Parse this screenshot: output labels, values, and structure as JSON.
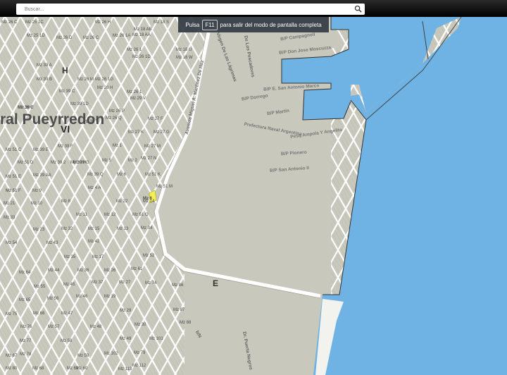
{
  "search": {
    "placeholder": "Buscar..."
  },
  "fullscreen": {
    "before": "Pulsa",
    "key": "F11",
    "after": "para salir del modo de pantalla completa"
  },
  "colors": {
    "sea": "#6fb2e4",
    "land": "#c8c8bc",
    "block": "#c2c4b8",
    "street": "#ffffff",
    "highlight": "#f5ef55"
  },
  "map": {
    "district_name": "ral Pueyrredon",
    "district_roman": "VI",
    "letter_h": "H",
    "letter_e": "E",
    "avenue": "Avenida Miguel A. Martinez De Hoz",
    "streets": [
      "Virgen De Las Lágrimas",
      "De Los Pescadores",
      "Pesq Ampola Y Angelito",
      "Prefectura Naval Argentina",
      "Dr. Puerta Negros",
      "b/N"
    ],
    "port_labels": [
      "B/P Campagnoli",
      "B/P Don Jose Moscuzza",
      "B/P E. San Antonio Marco",
      "B/P Dorrego",
      "B/P Martin",
      "B/P Pionero",
      "B/P San Antonio II"
    ],
    "blocks": [
      "Mz 26 C",
      "Mz 25 1C",
      "Mz 26 H",
      "Mz 18 AB",
      "Mz 18 S",
      "Mz 25 1D",
      "Mz 26 D",
      "Mz 26 C",
      "Mz 26 1A",
      "Mz 18 AA",
      "Mz 26 1",
      "Mz 26 1D",
      "Mz 18 U",
      "Mz 39 A",
      "Mz 39 B",
      "Mz 26 1G",
      "Mz 18 W",
      "Mz 39 C",
      "Mz 26 M",
      "Mz 26 H",
      "Mz 26 1",
      "Mz 29 V",
      "Mz 39 F",
      "Mz 26 P",
      "Mz 26 Q",
      "Mz 27 K",
      "Mz 27 G",
      "Mz 27 F",
      "Mz 39 C",
      "Mz 39 1D",
      "Mz 39 T",
      "Mz 1",
      "Mz 27 M",
      "Mz 51 C",
      "Mz 39 E",
      "Mz 39 F",
      "Mz 39 G",
      "Mz 51 D",
      "Mz 39 2",
      "Mz 39 H",
      "Mz 39 Q",
      "Mz 2",
      "Mz 27 N",
      "Mz 51 E",
      "Mz 51 F",
      "Mz 39 AA",
      "Mz 6",
      "Mz 5",
      "Mz 51 K",
      "Mz 51 I",
      "Mz 9",
      "Mz 4 A",
      "Mz 51 M",
      "Mz 21",
      "Mz 10",
      "Mz 8",
      "Mz 22",
      "Mz 14",
      "Mz 11",
      "Mz 12",
      "Mz 51 O",
      "Mz 33",
      "Mz 32",
      "Mz 23",
      "Mz 15",
      "Mz 13",
      "Mz 34",
      "Mz 42",
      "Mz 43",
      "Mz 35",
      "Mz 17",
      "Mz 52",
      "Mz 54",
      "Mz 44",
      "Mz 36",
      "Mz 26",
      "Mz 61",
      "Mz 64",
      "Mz 55",
      "Mz 45",
      "Mz 37",
      "Mz 27",
      "Mz 74",
      "Mz 65",
      "Mz 56",
      "Mz 46",
      "Mz 19",
      "Mz 86",
      "Mz 75",
      "Mz 66",
      "Mz 47",
      "Mz 29",
      "Mz 87",
      "Mz 76",
      "Mz 57",
      "Mz 48",
      "Mz 30",
      "Mz 88",
      "Mz 77",
      "Mz 58",
      "Mz 49",
      "Mz 101",
      "Mz 78",
      "Mz 67",
      "Mz 59",
      "Mz 102",
      "Mz 79",
      "Mz 68",
      "Mz 60",
      "Mz 113",
      "Mz 112",
      "Mz 80",
      "Mz 69"
    ],
    "selected_block": "Mz 6"
  }
}
